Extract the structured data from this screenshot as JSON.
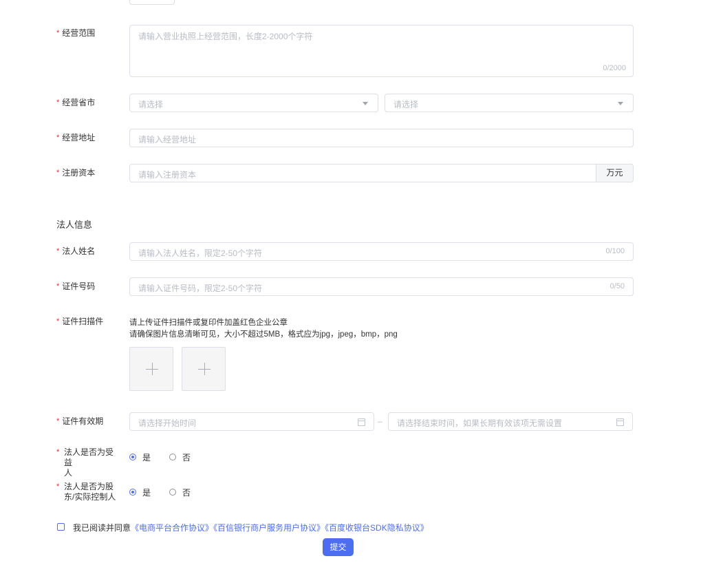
{
  "business_scope": {
    "label": "经营范围",
    "placeholder": "请输入营业执照上经营范围，长度2-2000个字符",
    "counter": "0/2000"
  },
  "business_region": {
    "label": "经营省市",
    "province_placeholder": "请选择",
    "city_placeholder": "请选择"
  },
  "business_address": {
    "label": "经营地址",
    "placeholder": "请输入经营地址"
  },
  "registered_capital": {
    "label": "注册资本",
    "placeholder": "请输入注册资本",
    "unit": "万元"
  },
  "legal_section": {
    "title": "法人信息"
  },
  "legal_name": {
    "label": "法人姓名",
    "placeholder": "请输入法人姓名，限定2-50个字符",
    "counter": "0/100"
  },
  "id_number": {
    "label": "证件号码",
    "placeholder": "请输入证件号码，限定2-50个字符",
    "counter": "0/50"
  },
  "id_scan": {
    "label": "证件扫描件",
    "hint_line1": "请上传证件扫描件或复印件加盖红色企业公章",
    "hint_line2": "请确保图片信息清晰可见，大小不超过5MB，格式应为jpg，jpeg，bmp，png",
    "upload_icon": "plus-icon"
  },
  "id_validity": {
    "label": "证件有效期",
    "start_placeholder": "请选择开始时间",
    "separator": "–",
    "end_placeholder": "请选择结束时间，如果长期有效该项无需设置",
    "icon": "calendar-icon"
  },
  "beneficiary": {
    "label_line1": "法人是否为受益",
    "label_line2": "人",
    "yes": "是",
    "no": "否",
    "selected": "是"
  },
  "controller": {
    "label_line1": "法人是否为股",
    "label_line2": "东/实际控制人",
    "yes": "是",
    "no": "否",
    "selected": "是"
  },
  "agreement": {
    "prefix": "我已阅读并同意",
    "links": [
      "《电商平台合作协议》",
      "《百信银行商户服务用户协议》",
      "《百度收银台SDK隐私协议》"
    ],
    "checked": false
  },
  "submit_label": "提交",
  "required_mark": "*",
  "colors": {
    "primary": "#4e6ef2",
    "required": "#f5222d",
    "border": "#dcdfe6",
    "placeholder": "#b8bcc4"
  }
}
